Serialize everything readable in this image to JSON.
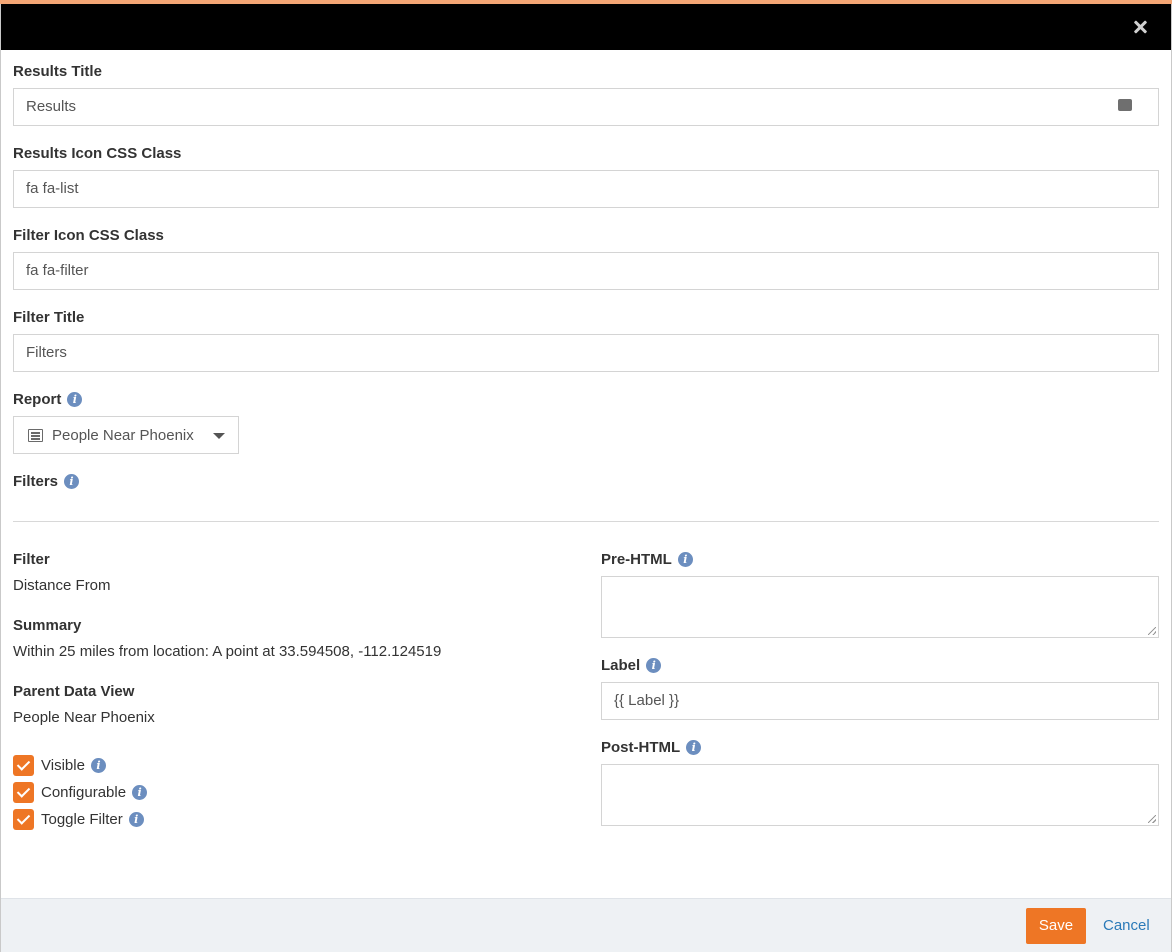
{
  "colors": {
    "accent": "#ee7625",
    "link": "#2a7ab8",
    "info": "#6c8ebf",
    "header": "#000000"
  },
  "header": {
    "close_icon": "close-icon"
  },
  "fields": {
    "results_title": {
      "label": "Results Title",
      "value": "Results",
      "icon": "key-value-icon"
    },
    "results_icon_css": {
      "label": "Results Icon CSS Class",
      "value": "fa fa-list"
    },
    "filter_icon_css": {
      "label": "Filter Icon CSS Class",
      "value": "fa fa-filter"
    },
    "filter_title": {
      "label": "Filter Title",
      "value": "Filters"
    },
    "report": {
      "label": "Report",
      "selected": "People Near Phoenix",
      "icon": "list-icon"
    },
    "filters": {
      "label": "Filters"
    }
  },
  "filter_detail": {
    "filter_label": "Filter",
    "filter_value": "Distance From",
    "summary_label": "Summary",
    "summary_value": "Within 25 miles from location: A point at 33.594508, -112.124519",
    "parent_label": "Parent Data View",
    "parent_value": "People Near Phoenix",
    "checkboxes": [
      {
        "label": "Visible",
        "checked": true
      },
      {
        "label": "Configurable",
        "checked": true
      },
      {
        "label": "Toggle Filter",
        "checked": true
      }
    ],
    "pre_html_label": "Pre-HTML",
    "label_label": "Label",
    "label_value": "{{ Label }}",
    "post_html_label": "Post-HTML"
  },
  "footer": {
    "save_label": "Save",
    "cancel_label": "Cancel"
  }
}
